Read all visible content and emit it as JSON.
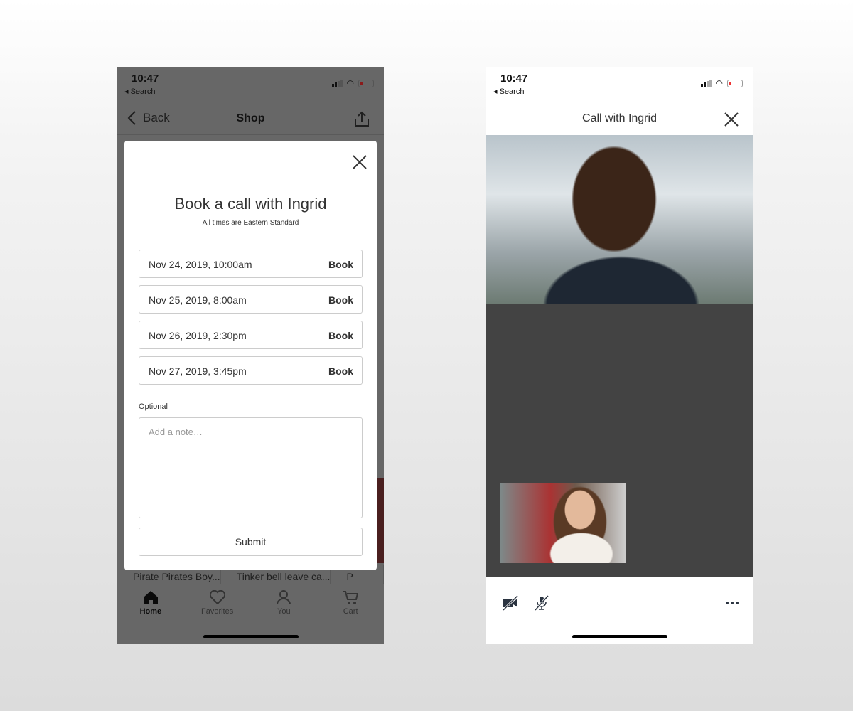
{
  "left_screen": {
    "status": {
      "time": "10:47",
      "back_app": "◂ Search"
    },
    "nav": {
      "back_label": "Back",
      "title": "Shop"
    },
    "products": [
      "Pirate Pirates Boy...",
      "Tinker bell leave ca...",
      "P"
    ],
    "tabbar": [
      {
        "label": "Home",
        "icon": "home-icon",
        "active": true
      },
      {
        "label": "Favorites",
        "icon": "heart-icon"
      },
      {
        "label": "You",
        "icon": "user-icon"
      },
      {
        "label": "Cart",
        "icon": "cart-icon"
      }
    ],
    "modal": {
      "title": "Book a call with Ingrid",
      "subtitle": "All times are Eastern Standard",
      "slots": [
        {
          "date": "Nov 24, 2019, 10:00am",
          "action": "Book"
        },
        {
          "date": "Nov 25, 2019, 8:00am",
          "action": "Book"
        },
        {
          "date": "Nov 26, 2019, 2:30pm",
          "action": "Book"
        },
        {
          "date": "Nov 27, 2019, 3:45pm",
          "action": "Book"
        }
      ],
      "optional_label": "Optional",
      "note_placeholder": "Add a note…",
      "submit_label": "Submit"
    }
  },
  "right_screen": {
    "status": {
      "time": "10:47",
      "back_app": "◂ Search"
    },
    "title": "Call with Ingrid",
    "controls": [
      "video-off-icon",
      "mic-off-icon",
      "more-icon"
    ]
  },
  "colors": {
    "overlay": "#666666",
    "stage": "#434343",
    "battery": "#e33333"
  }
}
